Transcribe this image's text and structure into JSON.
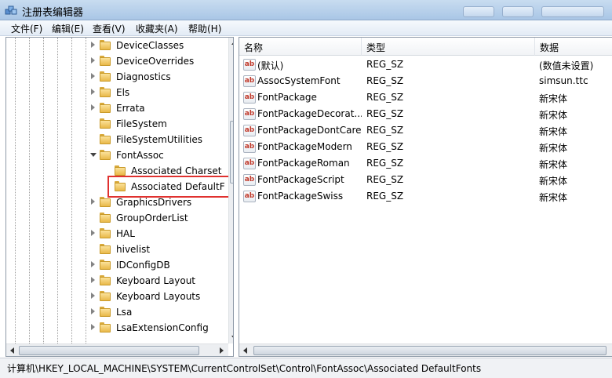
{
  "window": {
    "title": "注册表编辑器"
  },
  "menu": [
    "文件(F)",
    "编辑(E)",
    "查看(V)",
    "收藏夹(A)",
    "帮助(H)"
  ],
  "tree": [
    {
      "label": "DeviceClasses",
      "expander": "closed",
      "level": 0
    },
    {
      "label": "DeviceOverrides",
      "expander": "closed",
      "level": 0
    },
    {
      "label": "Diagnostics",
      "expander": "closed",
      "level": 0
    },
    {
      "label": "Els",
      "expander": "closed",
      "level": 0
    },
    {
      "label": "Errata",
      "expander": "closed",
      "level": 0
    },
    {
      "label": "FileSystem",
      "expander": "none",
      "level": 0
    },
    {
      "label": "FileSystemUtilities",
      "expander": "none",
      "level": 0
    },
    {
      "label": "FontAssoc",
      "expander": "open",
      "level": 0
    },
    {
      "label": "Associated Charset",
      "expander": "none",
      "level": 1
    },
    {
      "label": "Associated DefaultF",
      "expander": "none",
      "level": 1,
      "selected": true
    },
    {
      "label": "GraphicsDrivers",
      "expander": "closed",
      "level": 0
    },
    {
      "label": "GroupOrderList",
      "expander": "none",
      "level": 0
    },
    {
      "label": "HAL",
      "expander": "closed",
      "level": 0
    },
    {
      "label": "hivelist",
      "expander": "none",
      "level": 0
    },
    {
      "label": "IDConfigDB",
      "expander": "closed",
      "level": 0
    },
    {
      "label": "Keyboard Layout",
      "expander": "closed",
      "level": 0
    },
    {
      "label": "Keyboard Layouts",
      "expander": "closed",
      "level": 0
    },
    {
      "label": "Lsa",
      "expander": "closed",
      "level": 0
    },
    {
      "label": "LsaExtensionConfig",
      "expander": "closed",
      "level": 0
    }
  ],
  "columns": [
    "名称",
    "类型",
    "数据"
  ],
  "values": [
    {
      "name": "(默认)",
      "type": "REG_SZ",
      "data": "(数值未设置)"
    },
    {
      "name": "AssocSystemFont",
      "type": "REG_SZ",
      "data": "simsun.ttc"
    },
    {
      "name": "FontPackage",
      "type": "REG_SZ",
      "data": "新宋体"
    },
    {
      "name": "FontPackageDecorat...",
      "type": "REG_SZ",
      "data": "新宋体"
    },
    {
      "name": "FontPackageDontCare",
      "type": "REG_SZ",
      "data": "新宋体"
    },
    {
      "name": "FontPackageModern",
      "type": "REG_SZ",
      "data": "新宋体"
    },
    {
      "name": "FontPackageRoman",
      "type": "REG_SZ",
      "data": "新宋体"
    },
    {
      "name": "FontPackageScript",
      "type": "REG_SZ",
      "data": "新宋体"
    },
    {
      "name": "FontPackageSwiss",
      "type": "REG_SZ",
      "data": "新宋体"
    }
  ],
  "value_icon_text": "ab",
  "status": {
    "path": "计算机\\HKEY_LOCAL_MACHINE\\SYSTEM\\CurrentControlSet\\Control\\FontAssoc\\Associated DefaultFonts"
  },
  "colors": {
    "highlight_box": "#e0312f",
    "folder": "#f2c95c"
  }
}
